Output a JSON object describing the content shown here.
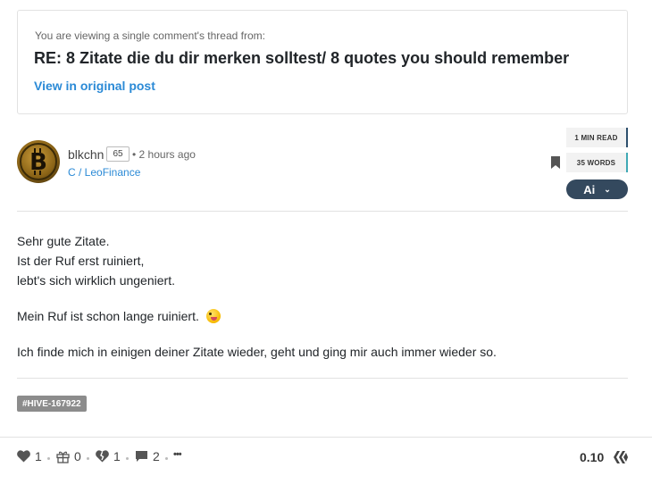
{
  "thread": {
    "notice": "You are viewing a single comment's thread from:",
    "title": "RE: 8 Zitate die du dir merken solltest/ 8 quotes you should remember",
    "link_label": "View in original post"
  },
  "author": {
    "name": "blkchn",
    "reputation": "65",
    "time": "• 2 hours ago",
    "community": "C / LeoFinance",
    "avatar_icon": "bitcoin-coin-avatar"
  },
  "meta": {
    "read_time": "1 MIN READ",
    "word_count": "35 WORDS",
    "ai_label": "Ai",
    "ai_chevron": "⌄"
  },
  "content": {
    "line1": "Sehr gute Zitate.",
    "line2": "Ist der Ruf erst ruiniert,",
    "line3": "lebt's sich wirklich ungeniert.",
    "para2": "Mein Ruf ist schon lange ruiniert.",
    "para3": "Ich finde mich in einigen deiner Zitate wieder, geht und ging mir auch immer wieder so."
  },
  "tags": [
    "#HIVE-167922"
  ],
  "footer": {
    "likes": "1",
    "tips": "0",
    "downvotes": "1",
    "comments": "2",
    "more": "•••",
    "payout": "0.10"
  },
  "colors": {
    "accent_link": "#2b8ad6",
    "ai_button": "#34495e",
    "tag_bg": "#8c8c8c"
  }
}
